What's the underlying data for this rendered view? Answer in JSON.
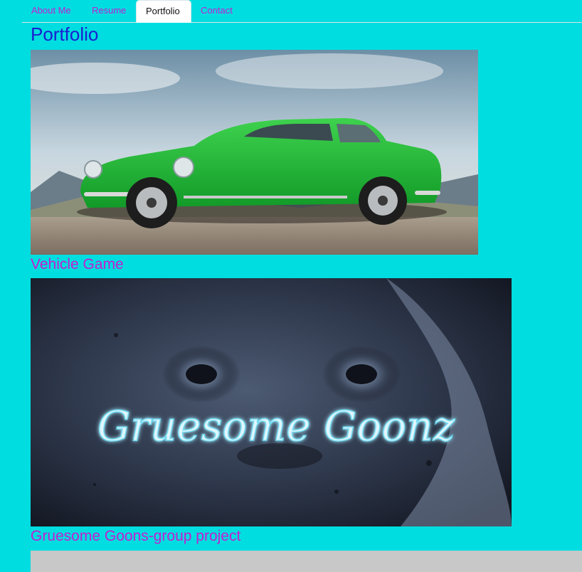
{
  "nav": {
    "items": [
      {
        "label": "About Me",
        "active": false
      },
      {
        "label": "Resume",
        "active": false
      },
      {
        "label": "Portfolio",
        "active": true
      },
      {
        "label": "Contact",
        "active": false
      }
    ]
  },
  "main": {
    "title": "Portfolio",
    "projects": [
      {
        "caption": "Vehicle Game",
        "image": "green-classic-sports-car-photo"
      },
      {
        "caption": "Gruesome Goons-group project",
        "image": "gruesome-goonz-banner",
        "image_text": "Gruesome Goonz"
      }
    ]
  },
  "colors": {
    "background": "#00dde0",
    "title": "#1b20d0",
    "link": "#c41fd0",
    "active_tab_bg": "#ffffff"
  }
}
